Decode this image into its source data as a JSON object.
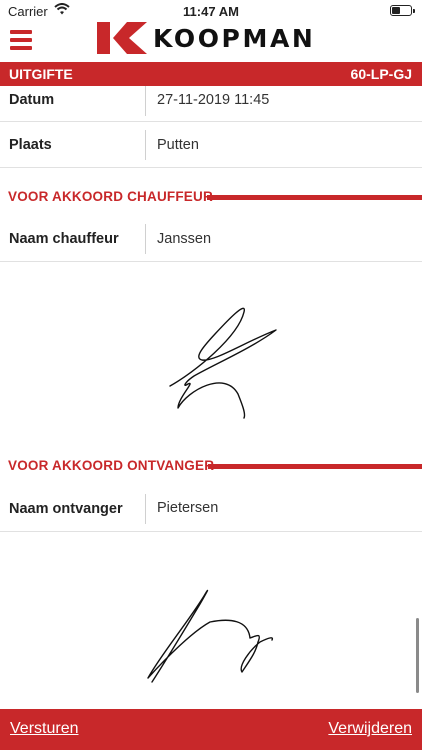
{
  "status_bar": {
    "carrier": "Carrier",
    "time": "11:47 AM"
  },
  "header": {
    "brand": "KOOPMAN"
  },
  "title_bar": {
    "left": "UITGIFTE",
    "right": "60-LP-GJ"
  },
  "fields": {
    "datum": {
      "label": "Datum",
      "value": "27-11-2019 11:45"
    },
    "plaats": {
      "label": "Plaats",
      "value": "Putten"
    }
  },
  "section_chauffeur": {
    "title": "VOOR AKKOORD CHAUFFEUR",
    "name_label": "Naam chauffeur",
    "name_value": "Janssen"
  },
  "section_ontvanger": {
    "title": "VOOR AKKOORD ONTVANGER",
    "name_label": "Naam ontvanger",
    "name_value": "Pietersen"
  },
  "footer": {
    "send": "Versturen",
    "delete": "Verwijderen"
  },
  "colors": {
    "brand_red": "#c8282a"
  }
}
